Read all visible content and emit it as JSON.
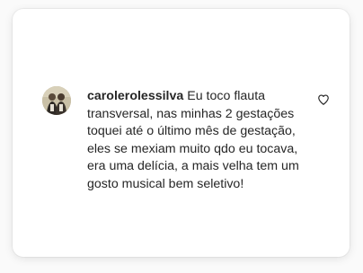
{
  "comment": {
    "username": "carolerolessilva",
    "text": "Eu toco flauta transversal, nas minhas 2 gestações toquei até o último mês de gestação, eles se mexiam muito qdo eu tocava, era uma delícia, a mais velha tem um gosto musical bem seletivo!",
    "avatar_icon": "profile-photo",
    "like_icon": "heart-outline-icon"
  },
  "colors": {
    "text": "#262626",
    "card": "#ffffff",
    "background": "#fafafa"
  }
}
